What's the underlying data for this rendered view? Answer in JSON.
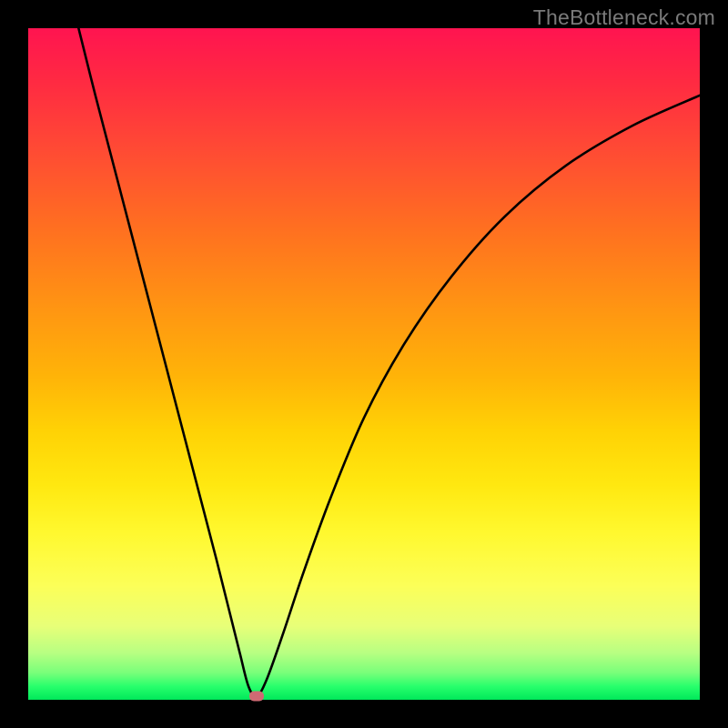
{
  "watermark": "TheBottleneck.com",
  "chart_data": {
    "type": "line",
    "title": "",
    "xlabel": "",
    "ylabel": "",
    "xlim": [
      0,
      100
    ],
    "ylim": [
      0,
      100
    ],
    "background_gradient": {
      "top_color": "#ff1450",
      "bottom_color": "#00e85a",
      "semantics": "top = high bottleneck, bottom = low bottleneck"
    },
    "series": [
      {
        "name": "bottleneck-curve",
        "color": "#000000",
        "x": [
          7.5,
          10,
          13,
          16,
          19,
          22,
          25,
          28,
          30,
          31.5,
          32.8,
          34,
          35.5,
          38,
          41,
          45,
          50,
          56,
          63,
          71,
          80,
          90,
          100
        ],
        "y": [
          100,
          90,
          78.5,
          67,
          55.5,
          44,
          32.5,
          21,
          13,
          7,
          2,
          0.5,
          3,
          10,
          19,
          30,
          42,
          53,
          63,
          72,
          79.5,
          85.5,
          90
        ]
      }
    ],
    "marker": {
      "x": 34,
      "y": 0.5,
      "color": "#cf6a73",
      "shape": "rounded-rect"
    }
  }
}
